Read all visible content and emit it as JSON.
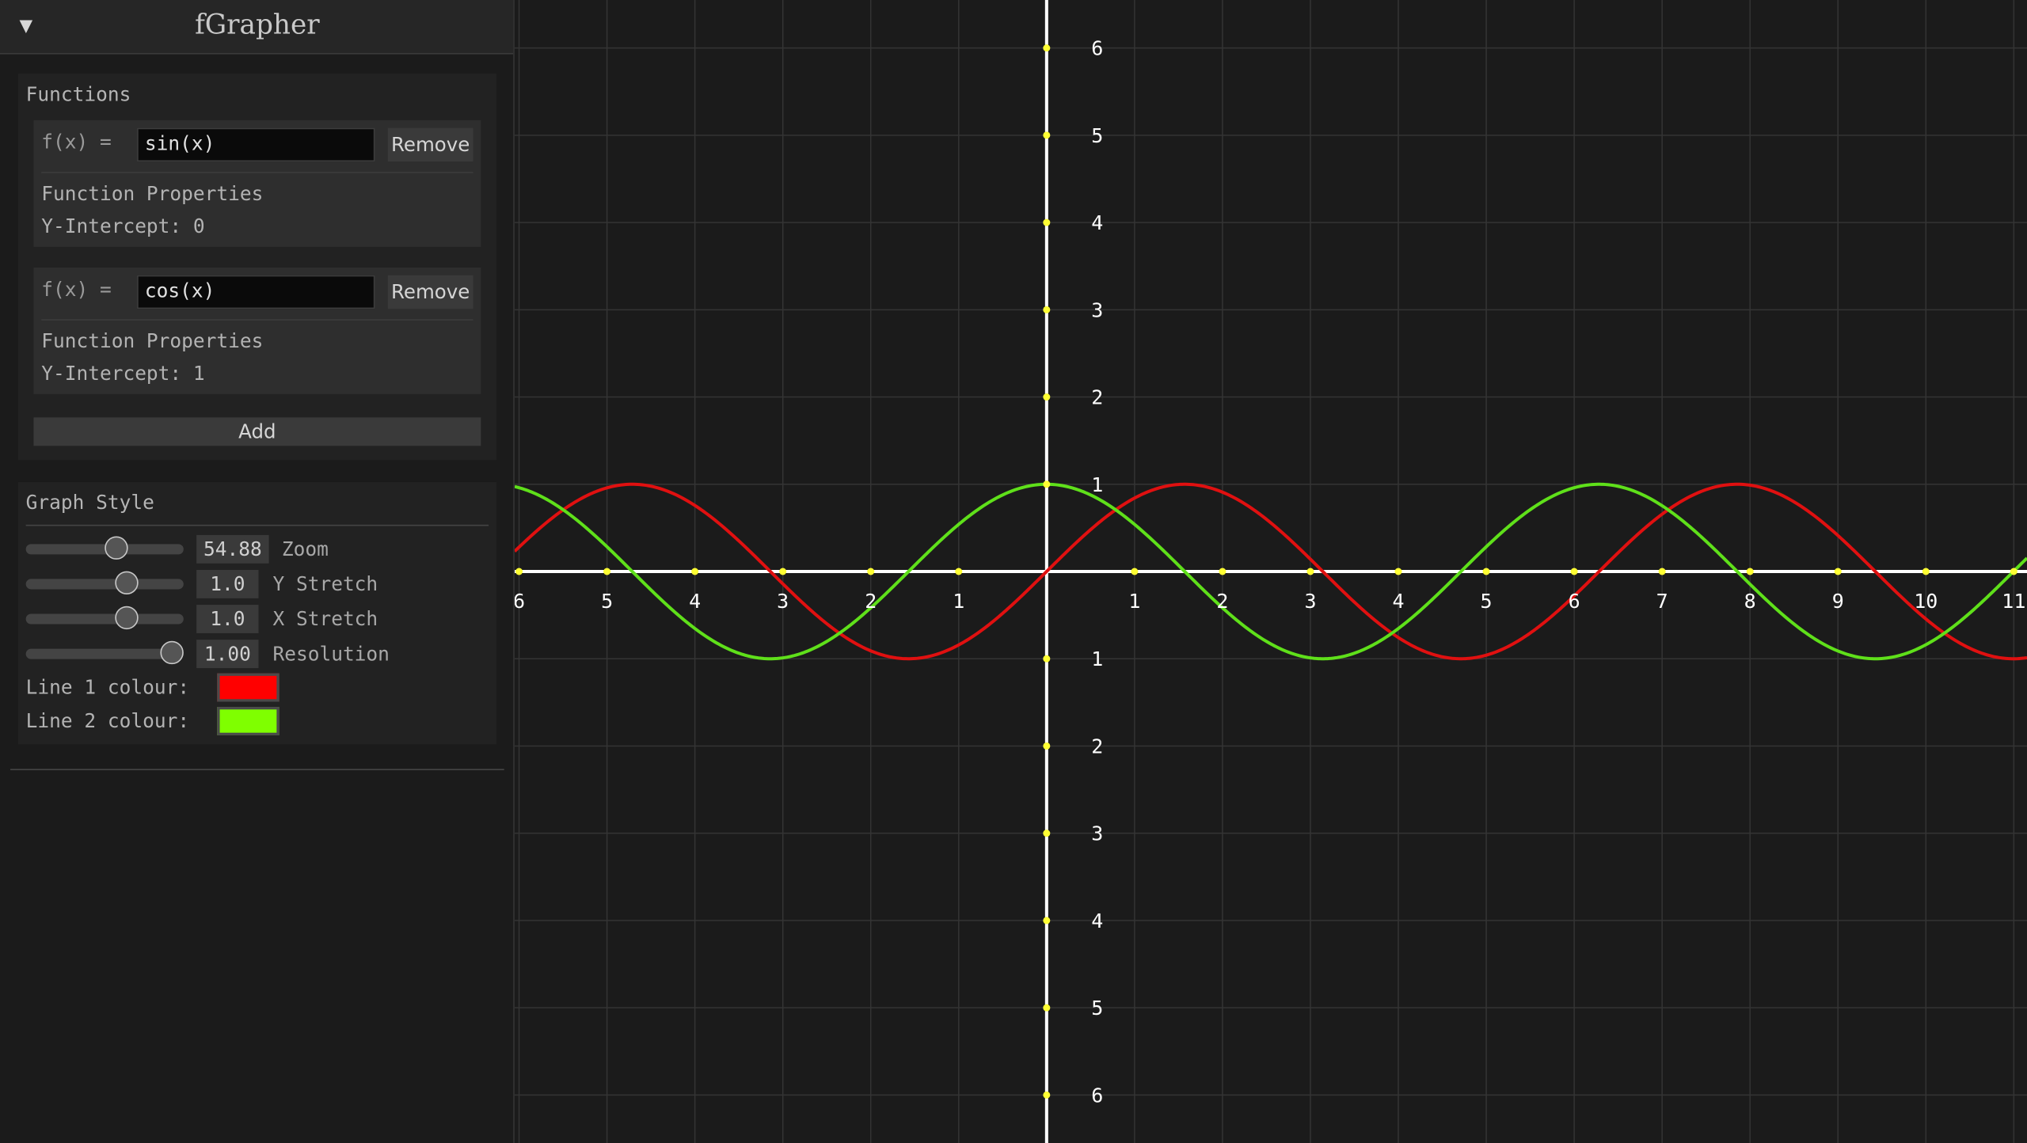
{
  "app": {
    "title": "fGrapher",
    "collapse_icon": "▼"
  },
  "functions_panel": {
    "title": "Functions",
    "items": [
      {
        "fx_label": "f(x) =",
        "expression": "sin(x)",
        "remove_label": "Remove",
        "properties_title": "Function Properties",
        "y_intercept": "Y-Intercept: 0"
      },
      {
        "fx_label": "f(x) =",
        "expression": "cos(x)",
        "remove_label": "Remove",
        "properties_title": "Function Properties",
        "y_intercept": "Y-Intercept: 1"
      }
    ],
    "add_label": "Add"
  },
  "graph_style": {
    "title": "Graph Style",
    "sliders": [
      {
        "label": "Zoom",
        "value": "54.88",
        "position": 0.57
      },
      {
        "label": "Y Stretch",
        "value": "1.0",
        "position": 0.64
      },
      {
        "label": "X Stretch",
        "value": "1.0",
        "position": 0.64
      },
      {
        "label": "Resolution",
        "value": "1.00",
        "position": 0.93
      }
    ],
    "line1_label": "Line 1 colour:",
    "line2_label": "Line 2 colour:",
    "line1_color": "#ff0000",
    "line2_color": "#7fff00"
  },
  "chart_data": {
    "type": "line",
    "x_range": [
      -6.05,
      11.15
    ],
    "y_range": [
      -6.55,
      6.55
    ],
    "x_tick_labels": [
      "6",
      "5",
      "4",
      "3",
      "2",
      "1",
      "1",
      "2",
      "3",
      "4",
      "5",
      "6",
      "7",
      "8",
      "9",
      "10",
      "11"
    ],
    "x_tick_values": [
      -6,
      -5,
      -4,
      -3,
      -2,
      -1,
      1,
      2,
      3,
      4,
      5,
      6,
      7,
      8,
      9,
      10,
      11
    ],
    "y_tick_labels": [
      "6",
      "5",
      "4",
      "3",
      "2",
      "1",
      "1",
      "2",
      "3",
      "4",
      "5",
      "6"
    ],
    "y_tick_values": [
      6,
      5,
      4,
      3,
      2,
      1,
      -1,
      -2,
      -3,
      -4,
      -5,
      -6
    ],
    "series": [
      {
        "expression": "sin(x)",
        "color": "#e01010"
      },
      {
        "expression": "cos(x)",
        "color": "#5fe01a"
      }
    ],
    "grid": true,
    "axis_color": "#ffffff",
    "tick_dot_color": "#ffff33",
    "grid_color": "#343434"
  }
}
